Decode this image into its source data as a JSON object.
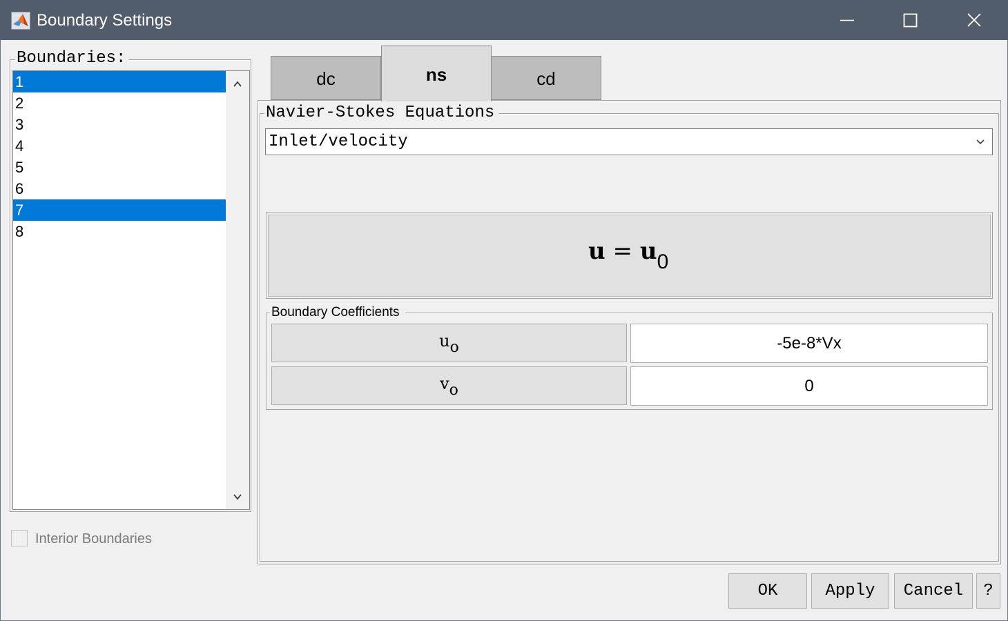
{
  "window": {
    "title": "Boundary Settings",
    "icon": "matlab-icon",
    "controls": [
      "minimize-icon",
      "maximize-icon",
      "close-icon"
    ]
  },
  "boundaries": {
    "legend": "Boundaries:",
    "items": [
      "1",
      "2",
      "3",
      "4",
      "5",
      "6",
      "7",
      "8"
    ],
    "selected": [
      "1",
      "7"
    ]
  },
  "interior_boundaries": {
    "label": "Interior Boundaries",
    "checked": false,
    "enabled": false
  },
  "tabs": [
    {
      "label": "dc",
      "active": false
    },
    {
      "label": "ns",
      "active": true
    },
    {
      "label": "cd",
      "active": false
    }
  ],
  "equations": {
    "legend": "Navier-Stokes Equations",
    "condition": "Inlet/velocity",
    "equation": {
      "lhs": "u",
      "eq": "=",
      "rhs": "u",
      "rhs_sub": "0"
    }
  },
  "coefficients": {
    "legend": "Boundary Coefficients",
    "rows": [
      {
        "symbol": "u",
        "sub": "o",
        "value": "-5e-8*Vx"
      },
      {
        "symbol": "v",
        "sub": "o",
        "value": "0"
      }
    ]
  },
  "buttons": {
    "ok": "OK",
    "apply": "Apply",
    "cancel": "Cancel",
    "help": "?"
  },
  "colors": {
    "titlebar": "#525d6b",
    "selection": "#0078d7",
    "active_tab": "#dcdcdc",
    "inactive_tab": "#bdbdbd"
  }
}
